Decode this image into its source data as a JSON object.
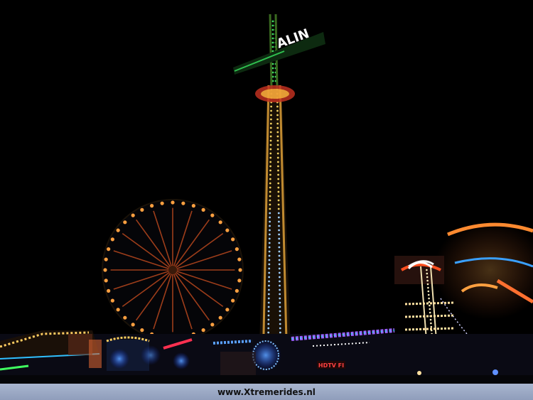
{
  "photo": {
    "tower_sign_text": "ALIN",
    "stall_sign_text": "HDTV FI"
  },
  "footer": {
    "watermark": "www.Xtremerides.nl"
  },
  "colors": {
    "sky": "#000000",
    "tower_lights": "#f0d060",
    "ferris_lights": "#ff9a40",
    "footer_bar": "#9aa7c4"
  }
}
